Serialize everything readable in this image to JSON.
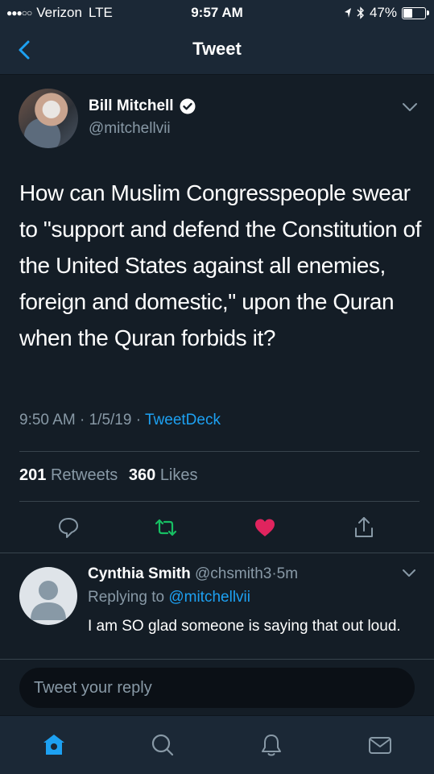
{
  "status_bar": {
    "signal_dots": "●●●○○",
    "carrier": "Verizon",
    "network": "LTE",
    "time": "9:57 AM",
    "battery_percent": "47%",
    "battery_level": 0.47
  },
  "nav": {
    "title": "Tweet",
    "back_icon": "chevron-left-icon"
  },
  "tweet": {
    "author_name": "Bill Mitchell",
    "author_handle": "@mitchellvii",
    "verified": true,
    "text": "How can Muslim Congresspeople swear to \"support and defend the Constitution of the United States against all enemies, foreign and domestic,\" upon the Quran when the Quran forbids it?",
    "time": "9:50 AM",
    "date": "1/5/19",
    "source": "TweetDeck",
    "separator": "·",
    "retweets_count": "201",
    "retweets_label": "Retweets",
    "likes_count": "360",
    "likes_label": "Likes"
  },
  "actions": [
    {
      "name": "reply",
      "icon": "speech-bubble-icon"
    },
    {
      "name": "retweet",
      "icon": "retweet-icon",
      "color": "#17bf63"
    },
    {
      "name": "like",
      "icon": "heart-icon",
      "color": "#e0245e"
    },
    {
      "name": "share",
      "icon": "share-icon"
    }
  ],
  "reply": {
    "name": "Cynthia Smith",
    "handle": "@chsmith3",
    "time": "5m",
    "separator": "·",
    "replying_to_label": "Replying to",
    "replying_to_handle": "@mitchellvii",
    "text": "I am SO glad someone is saying that out loud."
  },
  "compose": {
    "placeholder": "Tweet your reply"
  },
  "tab_bar": {
    "items": [
      {
        "name": "home",
        "icon": "home-icon",
        "active": true
      },
      {
        "name": "search",
        "icon": "search-icon"
      },
      {
        "name": "notifications",
        "icon": "bell-icon"
      },
      {
        "name": "messages",
        "icon": "envelope-icon"
      }
    ]
  },
  "colors": {
    "background": "#141d26",
    "bar_background": "#1b2836",
    "accent": "#1da1f2",
    "secondary_text": "#8899a6",
    "retweet_green": "#17bf63",
    "like_red": "#e0245e"
  }
}
